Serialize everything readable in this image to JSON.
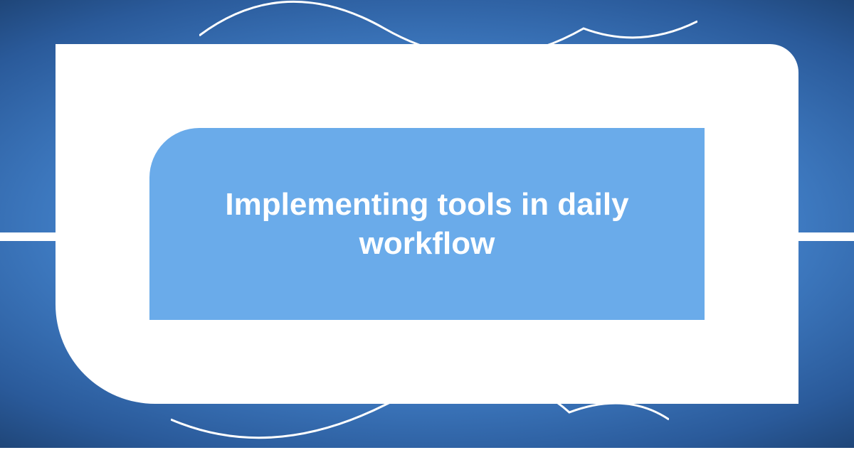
{
  "card": {
    "title": "Implementing tools in daily workflow"
  },
  "colors": {
    "inner_bg": "#6aabea",
    "outer_bg": "#ffffff",
    "text": "#ffffff"
  }
}
